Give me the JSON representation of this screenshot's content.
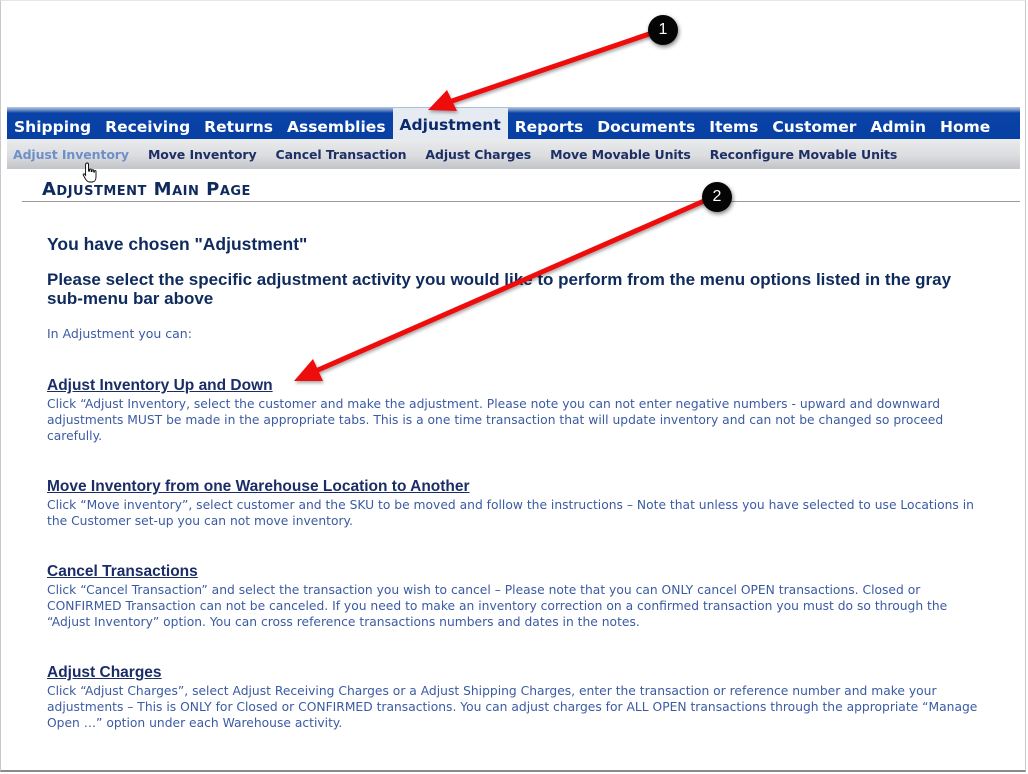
{
  "main_nav": {
    "tabs": [
      {
        "label": "Shipping",
        "active": false
      },
      {
        "label": "Receiving",
        "active": false
      },
      {
        "label": "Returns",
        "active": false
      },
      {
        "label": "Assemblies",
        "active": false
      },
      {
        "label": "Adjustment",
        "active": true
      },
      {
        "label": "Reports",
        "active": false
      },
      {
        "label": "Documents",
        "active": false
      },
      {
        "label": "Items",
        "active": false
      },
      {
        "label": "Customer",
        "active": false
      },
      {
        "label": "Admin",
        "active": false
      },
      {
        "label": "Home",
        "active": false
      }
    ]
  },
  "sub_nav": {
    "items": [
      {
        "label": "Adjust Inventory",
        "active": true
      },
      {
        "label": "Move Inventory",
        "active": false
      },
      {
        "label": "Cancel Transaction",
        "active": false
      },
      {
        "label": "Adjust Charges",
        "active": false
      },
      {
        "label": "Move Movable Units",
        "active": false
      },
      {
        "label": "Reconfigure Movable Units",
        "active": false
      }
    ]
  },
  "page": {
    "title": "Adjustment Main Page",
    "heading": "You have chosen \"Adjustment\"",
    "subheading": "Please select the specific adjustment activity you would like to perform from the menu options listed in the gray sub-menu bar above",
    "intro": "In Adjustment you can:",
    "sections": [
      {
        "link": "Adjust Inventory Up and Down",
        "description": "Click “Adjust Inventory, select the customer and make the adjustment. Please note you can not enter negative numbers - upward and downward adjustments MUST be made in the appropriate tabs. This is a one time transaction that will update inventory and can not be changed so proceed carefully."
      },
      {
        "link": "Move Inventory from one Warehouse Location to Another",
        "description": "Click “Move inventory”, select customer and the SKU to be moved and follow the instructions – Note that unless you have selected to use Locations in the Customer set-up you can not move inventory."
      },
      {
        "link": "Cancel Transactions",
        "description": "Click “Cancel Transaction” and select the transaction you wish to cancel – Please note that you can ONLY cancel OPEN transactions. Closed or CONFIRMED Transaction can not be canceled. If you need to make an inventory correction on a confirmed transaction you must do so through the “Adjust Inventory” option. You can cross reference transactions numbers and dates in the notes."
      },
      {
        "link": "Adjust Charges",
        "description": "Click “Adjust Charges”, select Adjust Receiving Charges or a Adjust Shipping Charges, enter the transaction or reference number and make your adjustments – This is ONLY for Closed or CONFIRMED transactions. You can adjust charges for ALL OPEN transactions through the appropriate “Manage Open …” option under each Warehouse activity."
      }
    ]
  },
  "annotations": {
    "callouts": [
      {
        "number": "1",
        "points_to": "Adjustment tab"
      },
      {
        "number": "2",
        "points_to": "Adjust Inventory Up and Down link"
      }
    ],
    "arrow_color": "#ee1111"
  }
}
